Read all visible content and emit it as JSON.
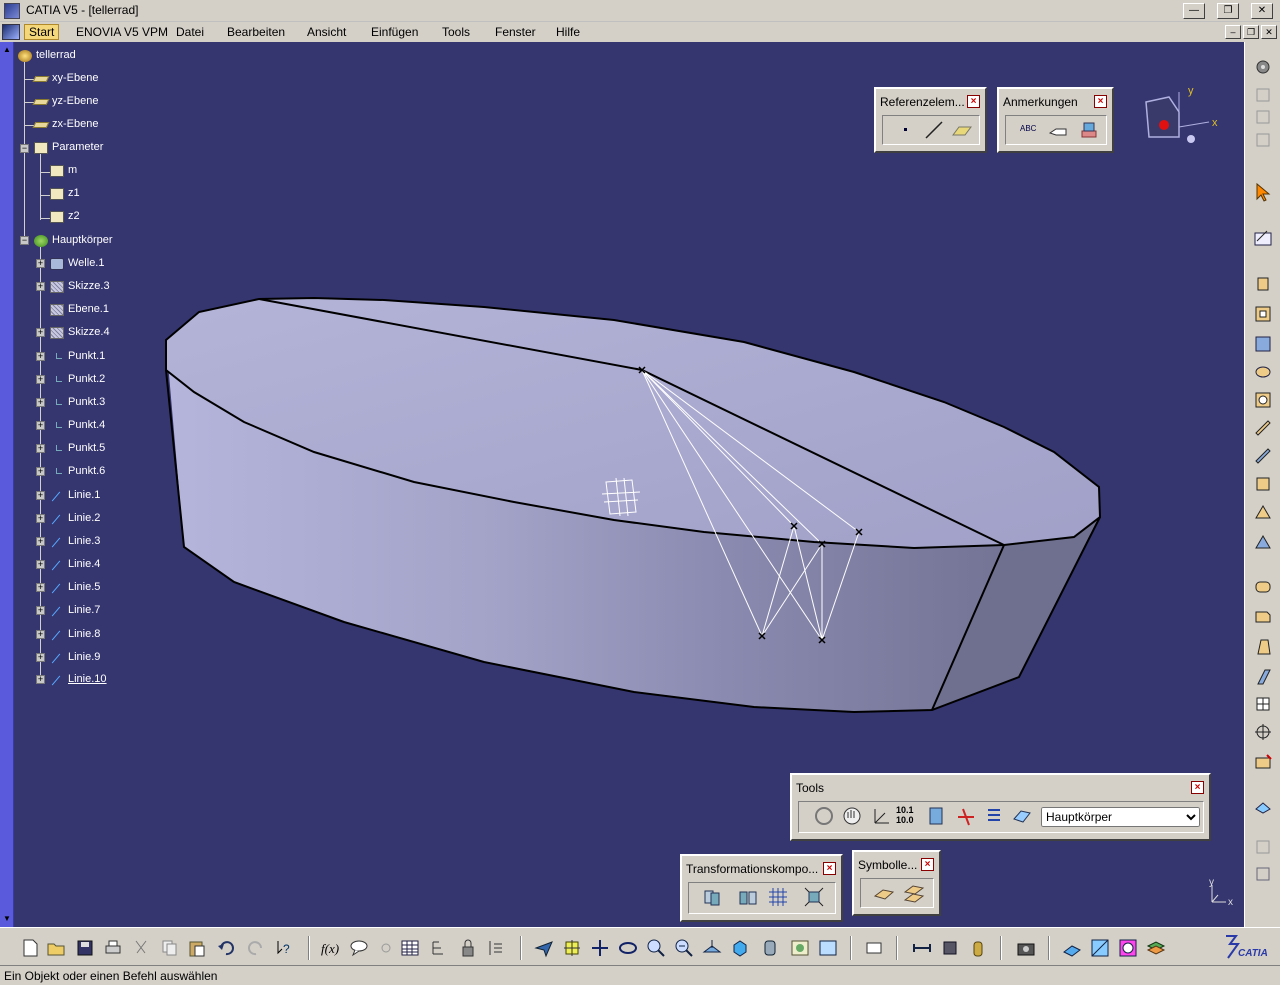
{
  "window": {
    "title": "CATIA V5 - [tellerrad]",
    "minimize": "—",
    "restore": "❐",
    "close": "✕"
  },
  "menu": {
    "items": [
      "Start",
      "ENOVIA V5 VPM",
      "Datei",
      "Bearbeiten",
      "Ansicht",
      "Einfügen",
      "Tools",
      "Fenster",
      "Hilfe"
    ],
    "mdi_min": "–",
    "mdi_restore": "❐",
    "mdi_close": "✕"
  },
  "tree": {
    "root": "tellerrad",
    "planes": [
      "xy-Ebene",
      "yz-Ebene",
      "zx-Ebene"
    ],
    "parameter": "Parameter",
    "params": [
      "m",
      "z1",
      "z2"
    ],
    "body": "Hauptkörper",
    "features": [
      "Welle.1",
      "Skizze.3",
      "Ebene.1",
      "Skizze.4",
      "Punkt.1",
      "Punkt.2",
      "Punkt.3",
      "Punkt.4",
      "Punkt.5",
      "Punkt.6",
      "Linie.1",
      "Linie.2",
      "Linie.3",
      "Linie.4",
      "Linie.5",
      "Linie.7",
      "Linie.8",
      "Linie.9",
      "Linie.10"
    ]
  },
  "toolbars": {
    "referenz": "Referenzelem...",
    "anmerkungen": "Anmerkungen",
    "tools": "Tools",
    "tools_combo": "Hauptkörper",
    "transform": "Transformationskompo...",
    "symbole": "Symbolle...",
    "abc": "ABC",
    "ratio_top": "10.1",
    "ratio_bottom": "10.0"
  },
  "compass": {
    "x": "x",
    "y": "y"
  },
  "axis_corner": {
    "x": "x",
    "y": "y"
  },
  "brand": "CATIA",
  "status": {
    "text": "Ein Objekt oder einen Befehl auswählen"
  },
  "colors": {
    "viewport": "#353570",
    "part": "#a6a6cc",
    "tree_text": "#ffffff"
  }
}
